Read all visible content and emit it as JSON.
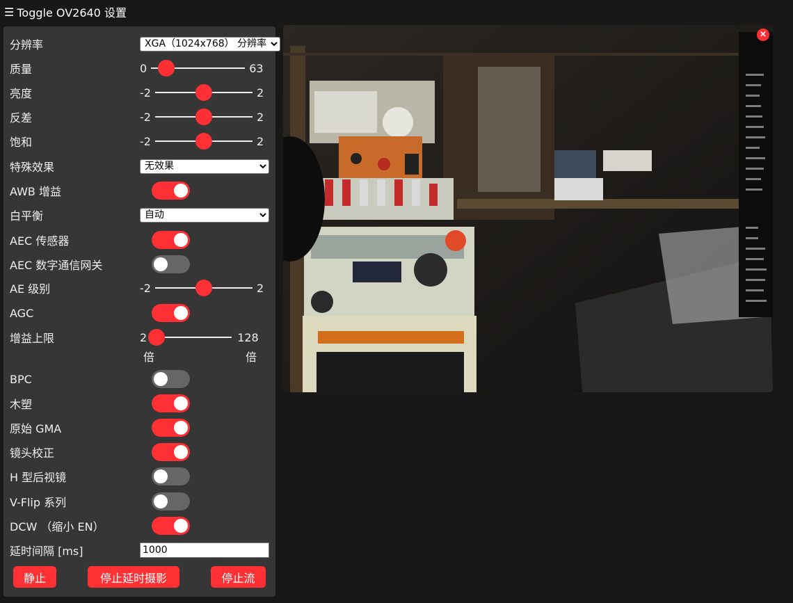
{
  "header": {
    "menu_icon": "☰",
    "title": "Toggle OV2640 设置"
  },
  "controls": {
    "resolution": {
      "label": "分辨率",
      "value": "XGA（1024x768） 分辨率"
    },
    "quality": {
      "label": "质量",
      "min": "0",
      "max": "63",
      "value": 10
    },
    "brightness": {
      "label": "亮度",
      "min": "-2",
      "max": "2",
      "value": 0
    },
    "contrast": {
      "label": "反差",
      "min": "-2",
      "max": "2",
      "value": 0
    },
    "saturation": {
      "label": "饱和",
      "min": "-2",
      "max": "2",
      "value": 0
    },
    "special_effect": {
      "label": "特殊效果",
      "value": "无效果"
    },
    "awb_gain": {
      "label": "AWB 增益",
      "on": true
    },
    "white_balance": {
      "label": "白平衡",
      "value": "自动"
    },
    "aec_sensor": {
      "label": "AEC 传感器",
      "on": true
    },
    "aec_dsp": {
      "label": "AEC 数字通信网关",
      "on": false
    },
    "ae_level": {
      "label": "AE 级别",
      "min": "-2",
      "max": "2",
      "value": 0
    },
    "agc": {
      "label": "AGC",
      "on": true
    },
    "gain_ceiling": {
      "label": "增益上限",
      "min": "2",
      "min_unit": "倍",
      "max": "128",
      "max_unit": "倍",
      "value": 2
    },
    "bpc": {
      "label": "BPC",
      "on": false
    },
    "wpc": {
      "label": "木塑",
      "on": true
    },
    "raw_gma": {
      "label": "原始 GMA",
      "on": true
    },
    "lens_correction": {
      "label": "镜头校正",
      "on": true
    },
    "h_mirror": {
      "label": "H 型后视镜",
      "on": false
    },
    "v_flip": {
      "label": "V-Flip 系列",
      "on": false
    },
    "dcw": {
      "label": "DCW （缩小 EN）",
      "on": true
    },
    "interval": {
      "label": "延时间隔 [ms]",
      "value": "1000"
    }
  },
  "buttons": {
    "still": "静止",
    "stop_timelapse": "停止延时摄影",
    "stop_stream": "停止流"
  },
  "stream": {
    "close_icon": "×"
  },
  "colors": {
    "accent": "#ff3034",
    "panel": "#363636",
    "background": "#181818"
  }
}
